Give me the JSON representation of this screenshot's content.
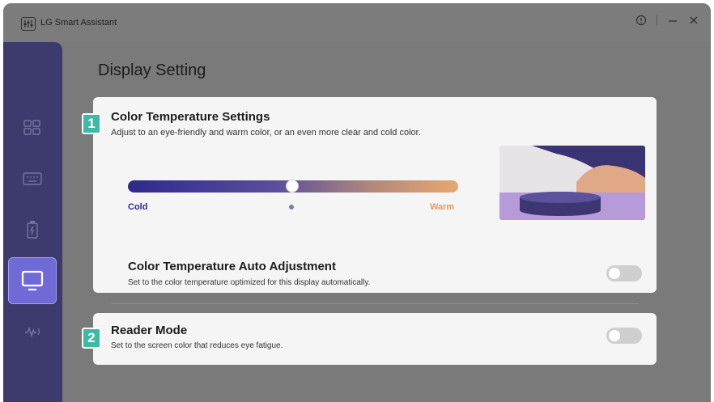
{
  "app": {
    "title": "LG Smart Assistant"
  },
  "page": {
    "title": "Display Setting"
  },
  "color_temp": {
    "badge": "1",
    "title": "Color Temperature Settings",
    "description": "Adjust to an eye-friendly and warm color, or an even more clear and cold color.",
    "slider": {
      "min_label": "Cold",
      "max_label": "Warm",
      "value_fraction": 0.5
    },
    "auto_title": "Color Temperature Auto Adjustment",
    "auto_description": "Set to the color temperature optimized for this display automatically.",
    "auto_enabled": false
  },
  "reader_mode": {
    "badge": "2",
    "title": "Reader Mode",
    "description": "Set to the screen color that reduces eye fatigue.",
    "enabled": false
  },
  "sidebar": {
    "items": [
      {
        "icon": "dashboard-icon",
        "active": false
      },
      {
        "icon": "keyboard-icon",
        "active": false
      },
      {
        "icon": "battery-icon",
        "active": false
      },
      {
        "icon": "monitor-icon",
        "active": true
      },
      {
        "icon": "audio-icon",
        "active": false
      }
    ]
  },
  "colors": {
    "sidebar": "#3d3a6e",
    "active_item": "#6f6ad6",
    "badge": "#3fb9a3",
    "cold": "#2e2a8a",
    "warm": "#e6a870"
  }
}
